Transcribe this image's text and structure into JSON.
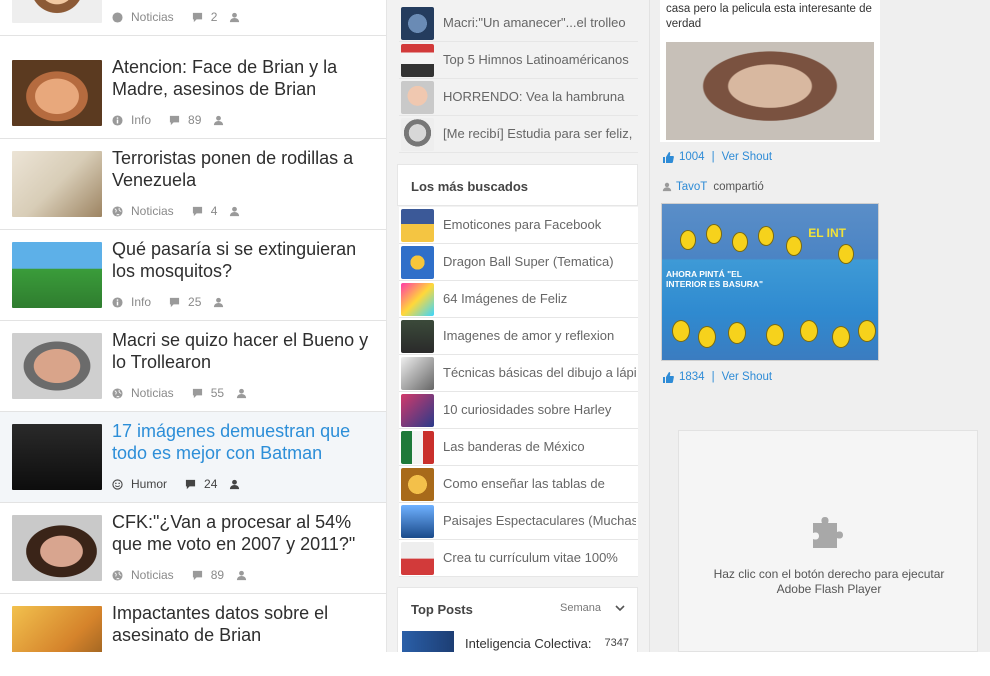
{
  "posts": [
    {
      "title": "",
      "category": "Noticias",
      "comments": "2",
      "thumb": "face"
    },
    {
      "title": "Atencion: Face de Brian y la Madre, asesinos de Brian",
      "category": "Info",
      "comments": "89",
      "thumb": "boy"
    },
    {
      "title": "Terroristas ponen de rodillas a Venezuela",
      "category": "Noticias",
      "comments": "4",
      "thumb": "coffee"
    },
    {
      "title": "Qué pasaría si se extinguieran los mosquitos?",
      "category": "Info",
      "comments": "25",
      "thumb": "simpsons"
    },
    {
      "title": "Macri se quizo hacer el Bueno y lo Trollearon",
      "category": "Noticias",
      "comments": "55",
      "thumb": "macri"
    },
    {
      "title": "17 imágenes demuestran que todo es mejor con Batman",
      "category": "Humor",
      "comments": "24",
      "thumb": "batman"
    },
    {
      "title": "CFK:\"¿Van a procesar al 54% que me voto en 2007 y 2011?\"",
      "category": "Noticias",
      "comments": "89",
      "thumb": "cfk"
    },
    {
      "title": "Impactantes datos sobre el asesinato de Brian",
      "category": "",
      "comments": "",
      "thumb": "last"
    }
  ],
  "recent": [
    "Macri:\"Un amanecer\"...el trolleo",
    "Top 5 Himnos Latinoaméricanos",
    "HORRENDO: Vea la hambruna",
    "[Me recibí] Estudia para ser feliz,"
  ],
  "most_searched": {
    "title": "Los más buscados",
    "items": [
      "Emoticones para Facebook",
      "Dragon Ball Super (Tematica)",
      "64 Imágenes de Feliz",
      "Imagenes de amor y reflexion",
      "Técnicas básicas del dibujo a lápiz",
      "10 curiosidades sobre Harley",
      "Las banderas de México",
      "Como enseñar las tablas de",
      "Paisajes Espectaculares (Muchas",
      "Crea tu currículum vitae 100%"
    ]
  },
  "top_posts": {
    "title": "Top Posts",
    "period": "Semana",
    "first": {
      "title": "Inteligencia Colectiva:",
      "points": "7347"
    }
  },
  "shouts": {
    "first_text": "casa pero la pelicula esta interesante de verdad",
    "first_likes": "1004",
    "view_label": "Ver Shout",
    "user": "TavoT",
    "shared": "compartió",
    "image_caption_1": "EL INT",
    "image_caption_2": "AHORA PINTÁ \"EL INTERIOR ES BASURA\"",
    "second_likes": "1834"
  },
  "flash": {
    "line1": "Haz clic con el botón derecho para ejecutar",
    "line2": "Adobe Flash Player"
  },
  "colors": {
    "accent": "#2e8bd6",
    "text": "#2e2e2e",
    "meta": "#8a8a8a"
  }
}
